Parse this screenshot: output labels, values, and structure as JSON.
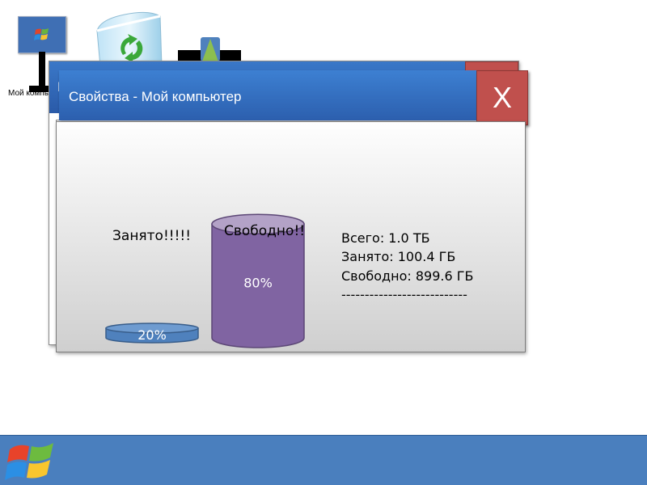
{
  "desktop": {
    "icons": [
      {
        "label": "Мой компьютер"
      },
      {
        "label": ""
      },
      {
        "label": ""
      }
    ]
  },
  "window_back": {
    "title_partial": "М"
  },
  "window": {
    "title": "Свойства - Мой компьютер",
    "close_label": "X",
    "used_label": "Занято!!!!!",
    "free_label": "Свободно!!",
    "info": {
      "total": "Всего: 1.0 ТБ",
      "used": "Занято: 100.4 ГБ",
      "free": "Свободно: 899.6 ГБ",
      "separator": "---------------------------"
    },
    "usage": {
      "used_percent_label": "20%",
      "free_percent_label": "80%",
      "used_fraction": 0.2,
      "free_fraction": 0.8
    }
  },
  "colors": {
    "title_bar": "#3a78c8",
    "close_button": "#c0504d",
    "used_cylinder": "#4f81bd",
    "free_cylinder": "#8064a2",
    "taskbar": "#4a7fbe"
  },
  "taskbar": {
    "start_icon": "windows-logo-icon"
  }
}
